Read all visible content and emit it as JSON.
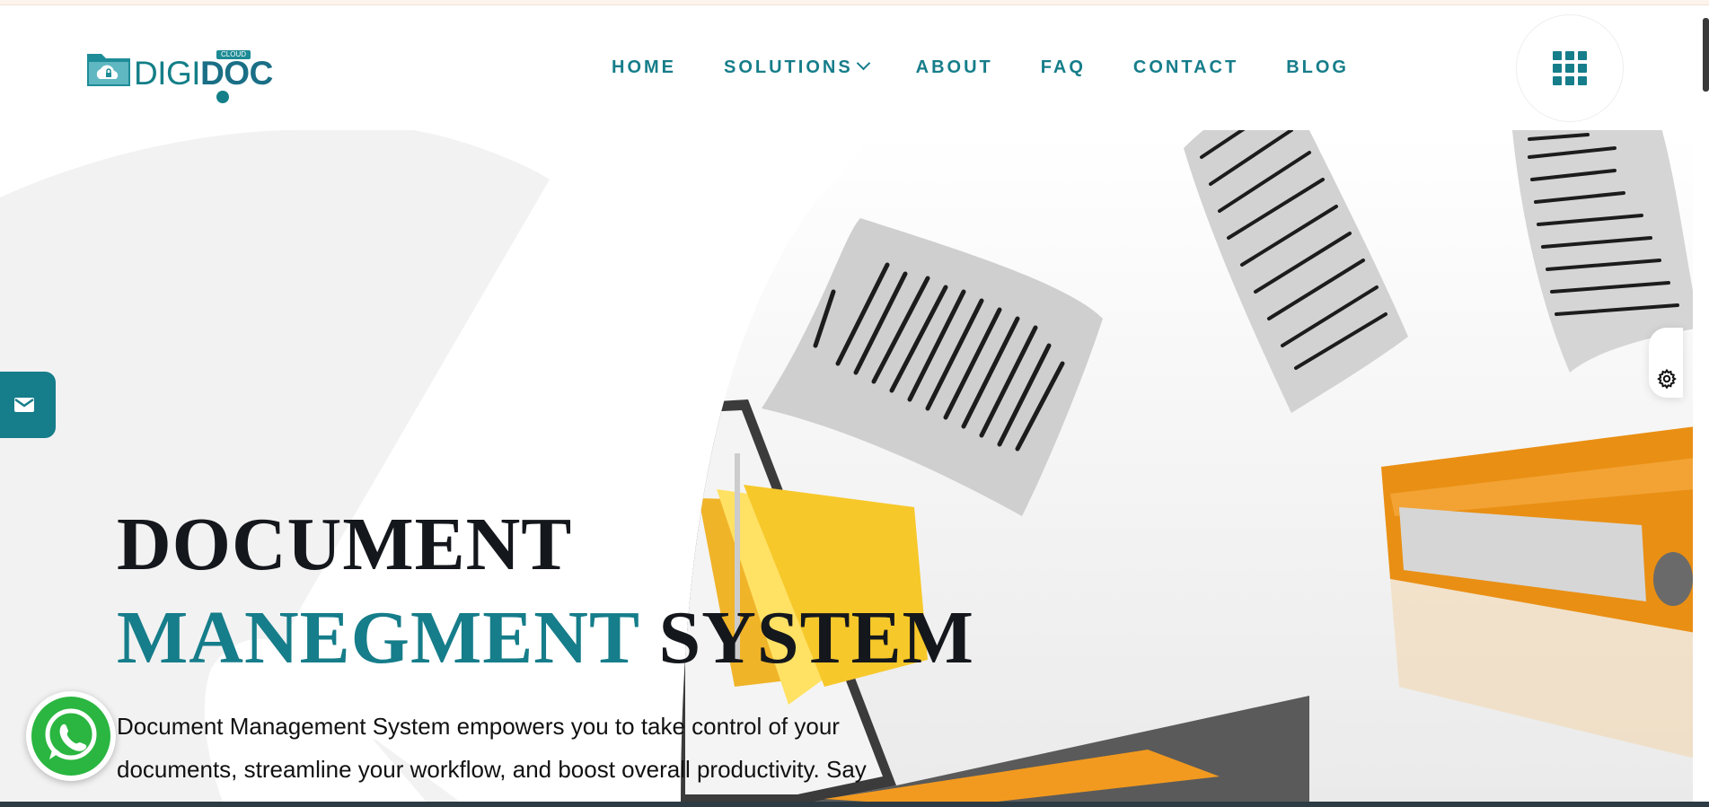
{
  "brand": {
    "logo_alt": "DIGIDOC CLOUD",
    "logo_word_light": "DIGI",
    "logo_word_bold": "DOC",
    "logo_tag": "CLOUD",
    "primary_color": "#167d8a"
  },
  "nav": {
    "items": [
      {
        "label": "HOME"
      },
      {
        "label": "SOLUTIONS",
        "has_dropdown": true
      },
      {
        "label": "ABOUT"
      },
      {
        "label": "FAQ"
      },
      {
        "label": "CONTACT"
      },
      {
        "label": "BLOG"
      }
    ],
    "menu_icon": "grid-menu-icon"
  },
  "hero": {
    "headline_line1": "DOCUMENT",
    "headline_accent": "MANEGMENT",
    "headline_rest": "SYSTEM",
    "subtext": "Document Management System empowers you to take control of your documents, streamline your workflow, and boost overall productivity. Say"
  },
  "widgets": {
    "mail_icon": "mail-icon",
    "settings_icon": "gear-icon",
    "whatsapp_icon": "whatsapp-icon"
  }
}
